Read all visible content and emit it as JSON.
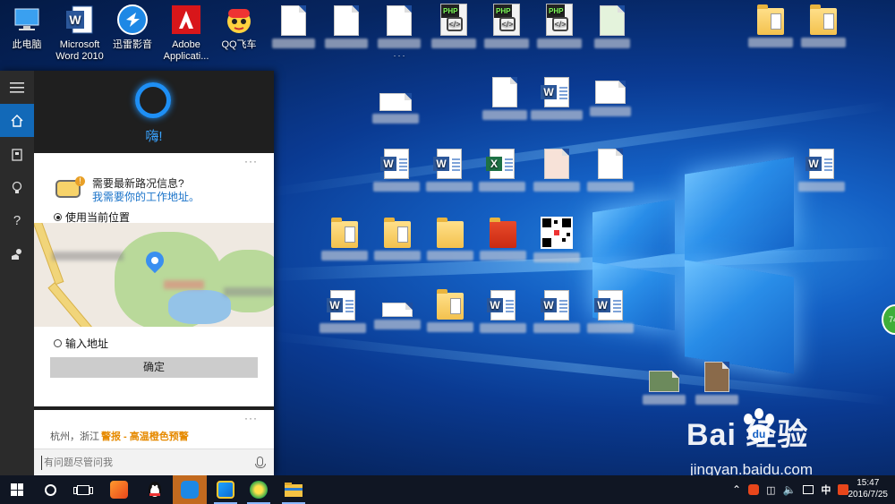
{
  "desktop": {
    "icons_top": [
      {
        "label": "此电脑",
        "kind": "pc"
      },
      {
        "label": "Microsoft Word 2010",
        "kind": "word"
      },
      {
        "label": "迅雷影音",
        "kind": "xunlei"
      },
      {
        "label": "Adobe Applicati...",
        "kind": "adobe"
      },
      {
        "label": "QQ飞车",
        "kind": "qqcar"
      }
    ],
    "partial_label": ". . ."
  },
  "cortana": {
    "greeting": "嗨!",
    "card_menu": "···",
    "traffic_question": "需要最新路况信息?",
    "work_address_prompt": "我需要你的工作地址。",
    "option_current_location": "使用当前位置",
    "option_enter_address": "输入地址",
    "confirm_button": "确定",
    "weather_location": "杭州，浙江",
    "weather_alert": "警报 - 高温橙色预警",
    "search_placeholder": "有问题尽管问我"
  },
  "taskbar": {
    "ime": "中",
    "time": "15:47",
    "date": "2016/7/25"
  },
  "watermark": {
    "logo": "Bai   经验",
    "url": "jingyan.baidu.com"
  },
  "colors": {
    "accent": "#1269b8",
    "cortana_ring": "#1e8ff5",
    "alert": "#e68a00",
    "active_taskbar": "#c26a1f"
  }
}
